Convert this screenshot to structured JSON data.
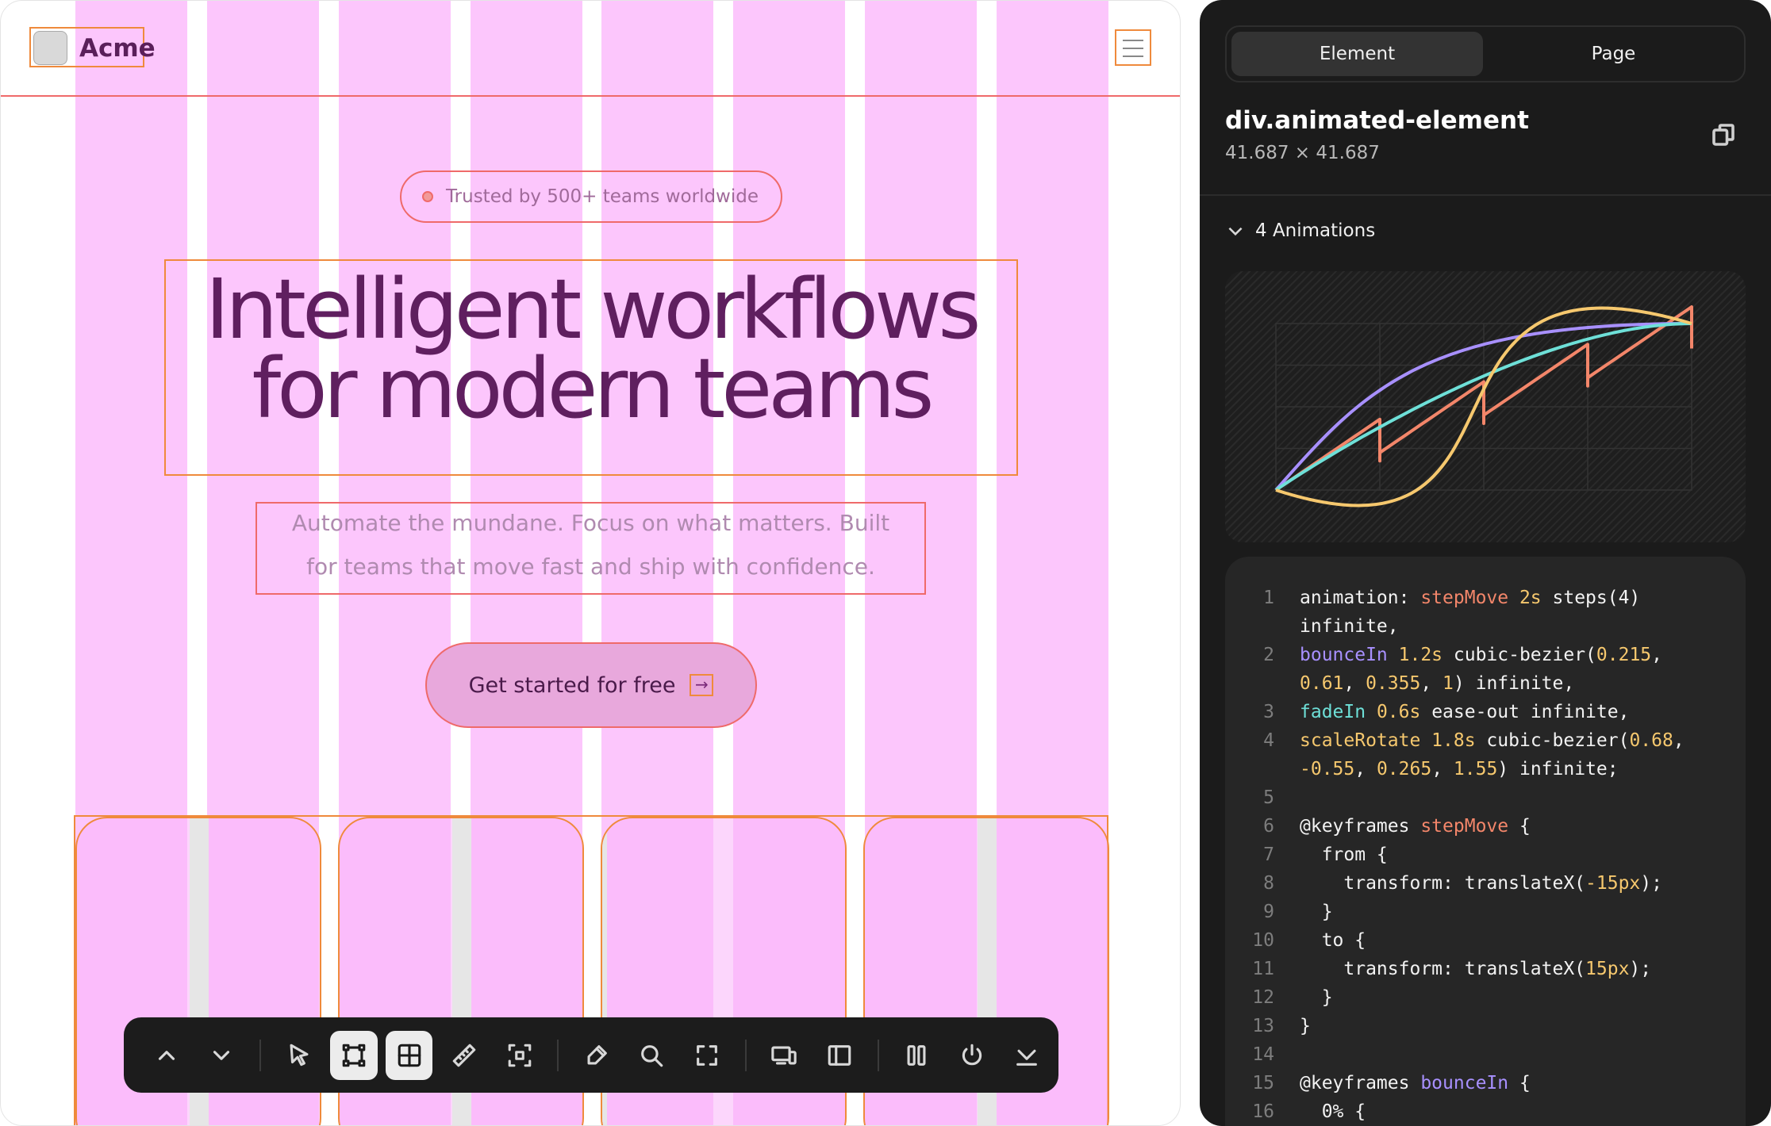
{
  "preview": {
    "brand": {
      "name": "Acme"
    },
    "badge": {
      "text": "Trusted by 500+ teams worldwide"
    },
    "hero": {
      "line1": "Intelligent workflows",
      "line2": "for modern teams"
    },
    "subtitle": {
      "line1": "Automate the mundane. Focus on what matters. Built",
      "line2": "for teams that move fast and ship with confidence."
    },
    "cta": {
      "label": "Get started for free",
      "arrow": "→"
    },
    "card_count": 4
  },
  "toolbar": {
    "items": [
      {
        "name": "chevron-up-icon",
        "active": false
      },
      {
        "name": "chevron-down-icon",
        "active": false
      },
      {
        "name": "separator"
      },
      {
        "name": "select-cursor-icon",
        "active": false
      },
      {
        "name": "frame-select-icon",
        "active": true
      },
      {
        "name": "grid-icon",
        "active": true
      },
      {
        "name": "ruler-icon",
        "active": false
      },
      {
        "name": "dashed-select-icon",
        "active": false
      },
      {
        "name": "separator"
      },
      {
        "name": "eyedropper-icon",
        "active": false
      },
      {
        "name": "magnifier-icon",
        "active": false
      },
      {
        "name": "fullscreen-icon",
        "active": false
      },
      {
        "name": "separator"
      },
      {
        "name": "devices-icon",
        "active": false
      },
      {
        "name": "sidebar-icon",
        "active": false
      },
      {
        "name": "separator"
      },
      {
        "name": "columns-icon",
        "active": false
      },
      {
        "name": "power-icon",
        "active": false
      },
      {
        "name": "collapse-icon",
        "active": false
      }
    ]
  },
  "panel": {
    "tabs": [
      {
        "label": "Element",
        "active": true
      },
      {
        "label": "Page",
        "active": false
      }
    ],
    "element": {
      "name": "div.animated-element",
      "size": "41.687 × 41.687"
    },
    "animations": {
      "label": "4 Animations"
    },
    "curve_colors": {
      "stepMove": "#f3866a",
      "bounceIn": "#a890ff",
      "fadeIn": "#6ee0d8",
      "scaleRotate": "#f6c86e"
    },
    "code": [
      {
        "n": "1",
        "parts": [
          [
            "white",
            "animation: "
          ],
          [
            "orange",
            "stepMove"
          ],
          [
            "yellow",
            " 2s"
          ],
          [
            "white",
            " steps(4)"
          ]
        ]
      },
      {
        "n": "",
        "parts": [
          [
            "white",
            "infinite,"
          ]
        ]
      },
      {
        "n": "2",
        "parts": [
          [
            "purple",
            "bounceIn"
          ],
          [
            "yellow",
            " 1.2s"
          ],
          [
            "white",
            " cubic-bezier("
          ],
          [
            "yellow",
            "0.215"
          ],
          [
            "white",
            ","
          ]
        ]
      },
      {
        "n": "",
        "parts": [
          [
            "yellow",
            "0.61"
          ],
          [
            "white",
            ", "
          ],
          [
            "yellow",
            "0.355"
          ],
          [
            "white",
            ", "
          ],
          [
            "yellow",
            "1"
          ],
          [
            "white",
            ") infinite,"
          ]
        ]
      },
      {
        "n": "3",
        "parts": [
          [
            "cyan",
            "fadeIn"
          ],
          [
            "yellow",
            " 0.6s"
          ],
          [
            "white",
            " ease-out infinite,"
          ]
        ]
      },
      {
        "n": "4",
        "parts": [
          [
            "yellow",
            "scaleRotate"
          ],
          [
            "yellow",
            " 1.8s"
          ],
          [
            "white",
            " cubic-bezier("
          ],
          [
            "yellow",
            "0.68"
          ],
          [
            "white",
            ","
          ]
        ]
      },
      {
        "n": "",
        "parts": [
          [
            "yellow",
            "-0.55"
          ],
          [
            "white",
            ", "
          ],
          [
            "yellow",
            "0.265"
          ],
          [
            "white",
            ", "
          ],
          [
            "yellow",
            "1.55"
          ],
          [
            "white",
            ") infinite;"
          ]
        ]
      },
      {
        "n": "5",
        "parts": []
      },
      {
        "n": "6",
        "parts": [
          [
            "white",
            "@keyframes "
          ],
          [
            "orange",
            "stepMove"
          ],
          [
            "white",
            " {"
          ]
        ]
      },
      {
        "n": "7",
        "parts": [
          [
            "white",
            "  from {"
          ]
        ]
      },
      {
        "n": "8",
        "parts": [
          [
            "white",
            "    transform: translateX("
          ],
          [
            "yellow",
            "-15px"
          ],
          [
            "white",
            ");"
          ]
        ]
      },
      {
        "n": "9",
        "parts": [
          [
            "white",
            "  }"
          ]
        ]
      },
      {
        "n": "10",
        "parts": [
          [
            "white",
            "  to {"
          ]
        ]
      },
      {
        "n": "11",
        "parts": [
          [
            "white",
            "    transform: translateX("
          ],
          [
            "yellow",
            "15px"
          ],
          [
            "white",
            ");"
          ]
        ]
      },
      {
        "n": "12",
        "parts": [
          [
            "white",
            "  }"
          ]
        ]
      },
      {
        "n": "13",
        "parts": [
          [
            "white",
            "}"
          ]
        ]
      },
      {
        "n": "14",
        "parts": []
      },
      {
        "n": "15",
        "parts": [
          [
            "white",
            "@keyframes "
          ],
          [
            "purple",
            "bounceIn"
          ],
          [
            "white",
            " {"
          ]
        ]
      },
      {
        "n": "16",
        "parts": [
          [
            "white",
            "  0% {"
          ]
        ]
      }
    ]
  }
}
